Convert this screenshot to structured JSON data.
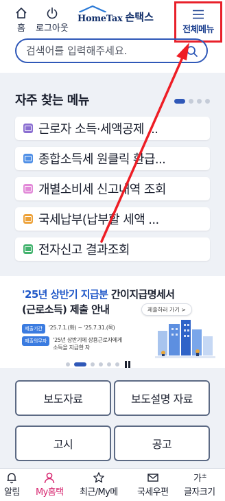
{
  "header": {
    "home_label": "홈",
    "logout_label": "로그아웃",
    "logo_text": "HomeTax",
    "logo_sub": "손택스",
    "menu_label": "전체메뉴"
  },
  "search": {
    "placeholder": "검색어를 입력해주세요."
  },
  "favorites": {
    "title": "자주 찾는 메뉴",
    "items": [
      {
        "label": "근로자 소득·세액공제 ...",
        "icon": "purple-screen-icon",
        "color": "#8b6fd1"
      },
      {
        "label": "종합소득세 원클릭 환급...",
        "icon": "blue-screen-icon",
        "color": "#4f8fe6"
      },
      {
        "label": "개별소비세 신고내역 조회",
        "icon": "pink-screen-icon",
        "color": "#e28ad8"
      },
      {
        "label": "국세납부(납부할 세액 ...",
        "icon": "orange-screen-icon",
        "color": "#eda23a"
      },
      {
        "label": "전자신고 결과조회",
        "icon": "green-screen-icon",
        "color": "#43b36e"
      }
    ]
  },
  "banner": {
    "title_highlight": "'25년 상반기 지급분",
    "title_rest": " 간이지급명세서",
    "title_line2": "(근로소득) 제출 안내",
    "cta_label": "제출하러 가기 >",
    "period_tag": "제출기간",
    "period_value": "'25.7.1.(화) ~ '25.7.31.(목)",
    "obligor_tag": "제출의무자",
    "obligor_value_1": "'25년 상반기에 상용근로자에게",
    "obligor_value_2": "소득을 지급한 자"
  },
  "press": {
    "press_release": "보도자료",
    "press_explanation": "보도설명 자료",
    "notice": "고시",
    "announcement": "공고"
  },
  "bottom_nav": {
    "alerts": "알림",
    "myhome": "My홈택",
    "recent": "최근/My메",
    "post": "국세우편",
    "font_size": "글자크기"
  },
  "colors": {
    "accent_blue": "#2f58b8",
    "highlight_red": "#e8202a",
    "active_pink": "#d6246e",
    "panel_bg": "#eef1f6"
  }
}
